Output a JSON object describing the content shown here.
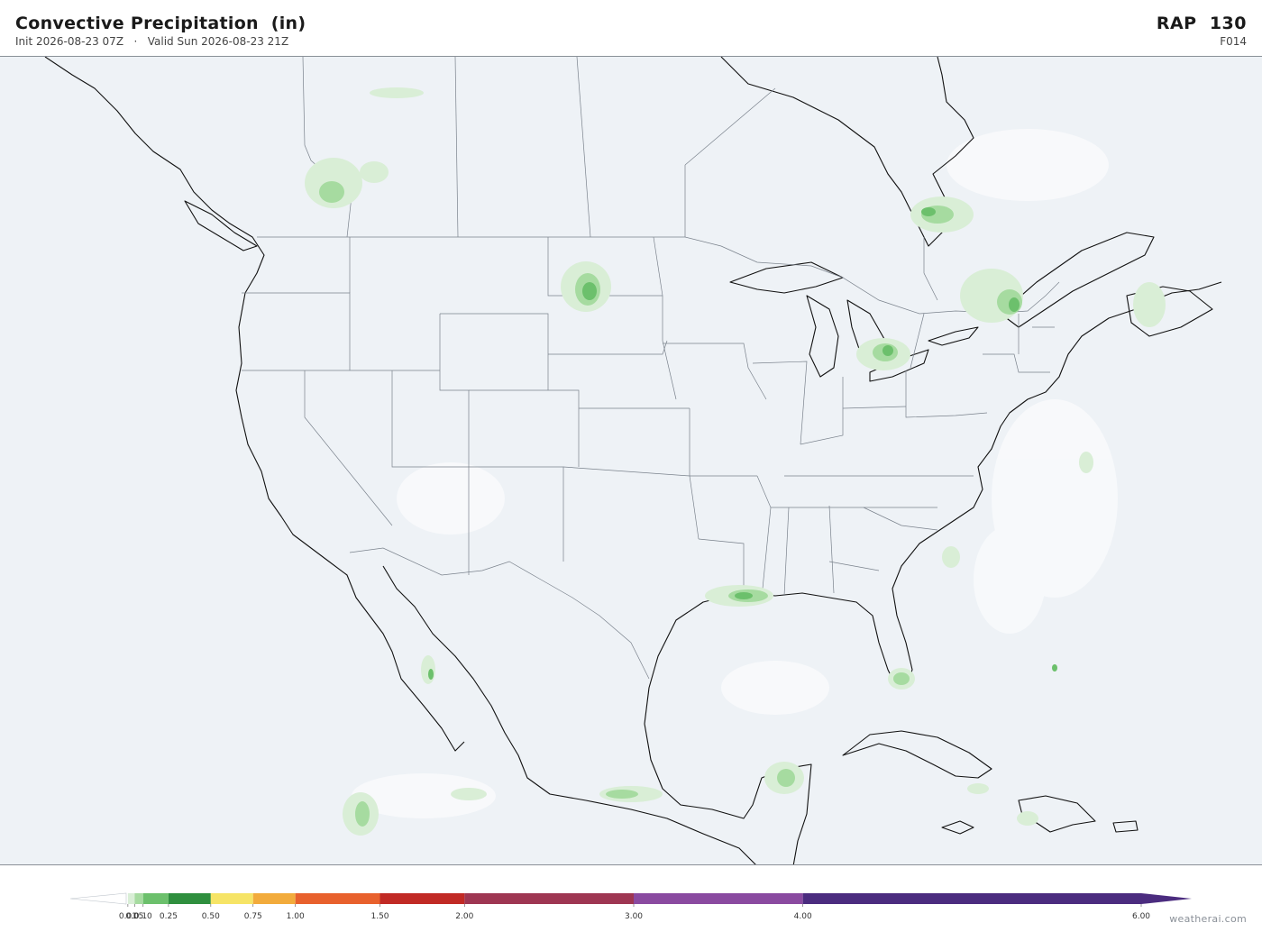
{
  "header": {
    "title": "Convective Precipitation  (in)",
    "subtitle": "Init 2026-08-23 07Z   ·   Valid Sun 2026-08-23 21Z",
    "model": "RAP  130",
    "forecast_hour": "F014"
  },
  "map": {
    "land_color": "#eef2f6",
    "coast_color": "#111111",
    "border_color": "#8a9098"
  },
  "colorbar": {
    "min": 0,
    "max": 6,
    "ticks": [
      "0.01",
      "0.05",
      "0.10",
      "0.25",
      "0.50",
      "0.75",
      "1.00",
      "1.50",
      "2.00",
      "3.00",
      "4.00",
      "6.00"
    ],
    "tick_values": [
      0.01,
      0.05,
      0.1,
      0.25,
      0.5,
      0.75,
      1.0,
      1.5,
      2.0,
      3.0,
      4.0,
      6.0
    ],
    "bins": [
      {
        "from": 0.01,
        "to": 0.05,
        "color": "#d9eed6"
      },
      {
        "from": 0.05,
        "to": 0.1,
        "color": "#a6dba0"
      },
      {
        "from": 0.1,
        "to": 0.25,
        "color": "#6cc06c"
      },
      {
        "from": 0.25,
        "to": 0.5,
        "color": "#2f8f3e"
      },
      {
        "from": 0.5,
        "to": 0.75,
        "color": "#f6e466"
      },
      {
        "from": 0.75,
        "to": 1.0,
        "color": "#f2ab3c"
      },
      {
        "from": 1.0,
        "to": 1.5,
        "color": "#e8612d"
      },
      {
        "from": 1.5,
        "to": 2.0,
        "color": "#c12a25"
      },
      {
        "from": 2.0,
        "to": 3.0,
        "color": "#9e3652"
      },
      {
        "from": 3.0,
        "to": 4.0,
        "color": "#8a4aa0"
      },
      {
        "from": 4.0,
        "to": 6.0,
        "color": "#4b2c7f"
      }
    ]
  },
  "credit": "weatherai.com"
}
